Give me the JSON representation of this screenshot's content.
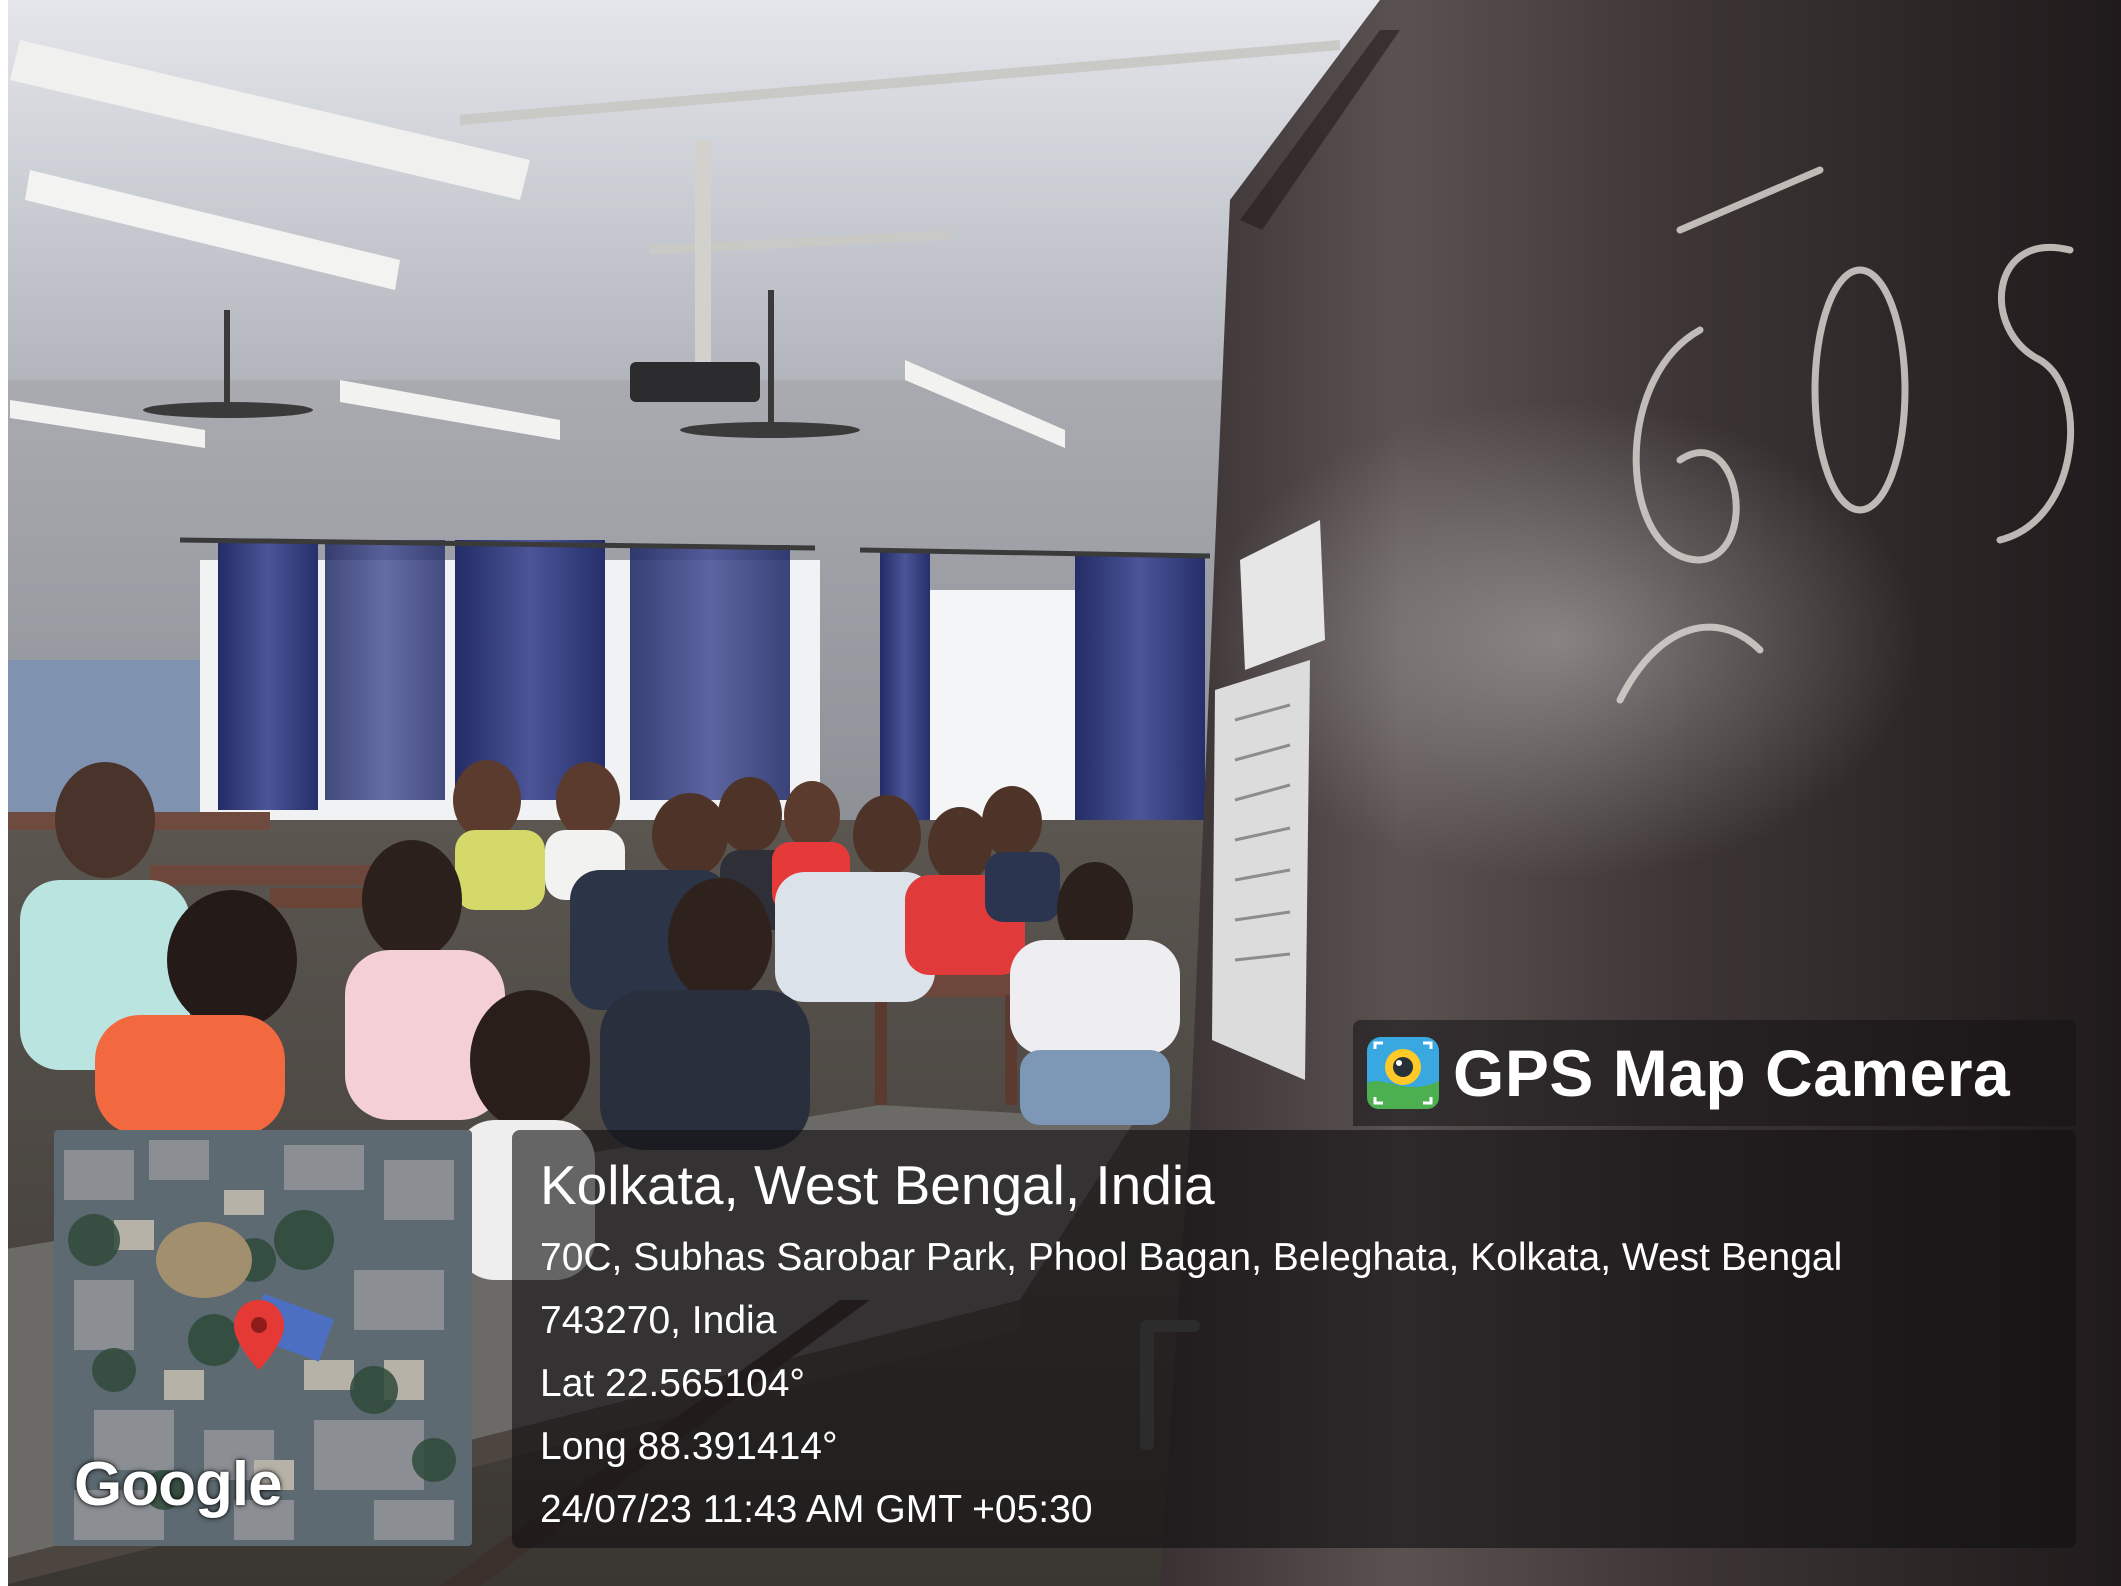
{
  "overlay": {
    "brand_label": "GPS Map Camera",
    "brand_icon": "map-camera-pin-icon",
    "map_attribution": "Google",
    "map_marker": "red-location-pin-icon",
    "location_title": "Kolkata, West Bengal, India",
    "address_line_1": "70C, Subhas Sarobar Park, Phool Bagan, Beleghata, Kolkata, West Bengal",
    "address_line_2": "743270, India",
    "latitude": "Lat 22.565104°",
    "longitude": "Long 88.391414°",
    "timestamp": "24/07/23 11:43 AM GMT +05:30"
  },
  "door_chalk_text": "605",
  "colors": {
    "panel_bg": "#141214",
    "text": "#ffffff",
    "curtain_blue": "#2f3a7a",
    "door_brown": "#2e2626",
    "pin_red": "#e53935"
  }
}
